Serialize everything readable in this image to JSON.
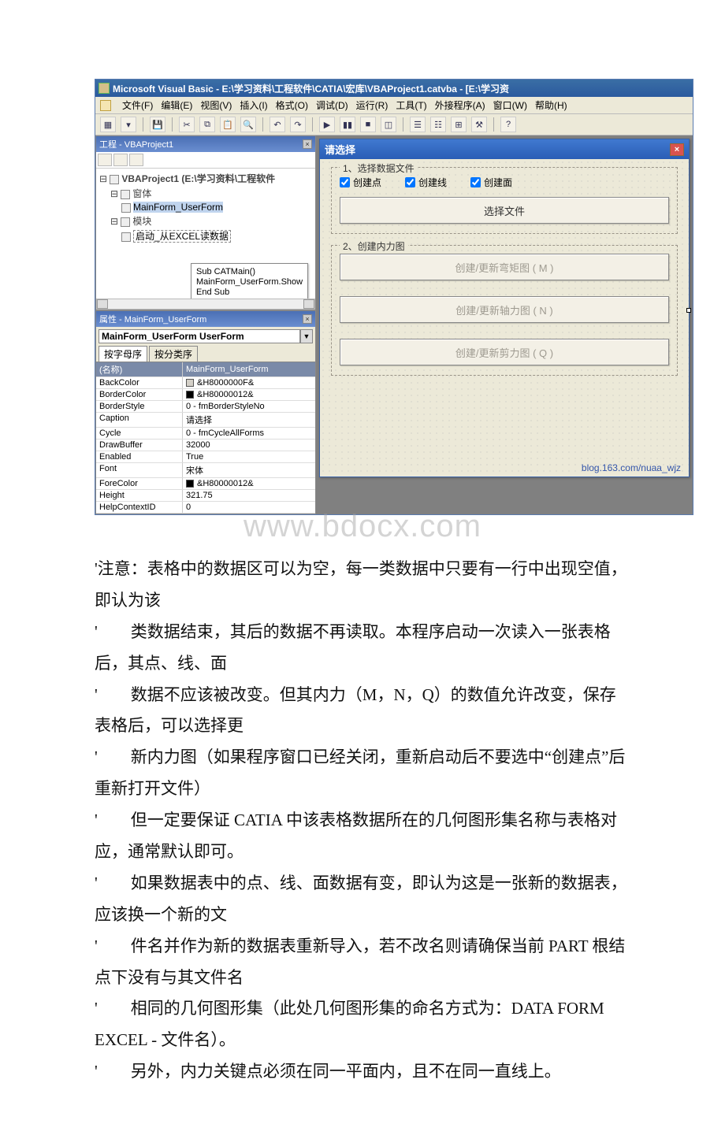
{
  "window": {
    "title": "Microsoft Visual Basic - E:\\学习资料\\工程软件\\CATIA\\宏库\\VBAProject1.catvba - [E:\\学习资"
  },
  "menu": {
    "file": "文件(F)",
    "edit": "编辑(E)",
    "view": "视图(V)",
    "insert": "插入(I)",
    "format": "格式(O)",
    "debug": "调试(D)",
    "run": "运行(R)",
    "tools": "工具(T)",
    "addins": "外接程序(A)",
    "window": "窗口(W)",
    "help": "帮助(H)"
  },
  "project_panel": {
    "title": "工程 - VBAProject1",
    "root": "VBAProject1 (E:\\学习资料\\工程软件",
    "forms_folder": "窗体",
    "form_item": "MainForm_UserForm",
    "modules_folder": "模块",
    "module_item": "启动_从EXCEL读数据"
  },
  "code_hint": {
    "line1": "Sub CATMain()",
    "line2": "MainForm_UserForm.Show",
    "line3": "End Sub"
  },
  "properties_panel": {
    "title": "属性 - MainForm_UserForm",
    "combo_value": "MainForm_UserForm UserForm",
    "tab_alpha": "按字母序",
    "tab_category": "按分类序",
    "header_name": "(名称)",
    "header_value": "MainForm_UserForm",
    "rows": [
      {
        "name": "BackColor",
        "value": "&H8000000F&",
        "swatch": "grey"
      },
      {
        "name": "BorderColor",
        "value": "&H80000012&",
        "swatch": "black"
      },
      {
        "name": "BorderStyle",
        "value": "0 - fmBorderStyleNo"
      },
      {
        "name": "Caption",
        "value": "请选择"
      },
      {
        "name": "Cycle",
        "value": "0 - fmCycleAllForms"
      },
      {
        "name": "DrawBuffer",
        "value": "32000"
      },
      {
        "name": "Enabled",
        "value": "True"
      },
      {
        "name": "Font",
        "value": "宋体"
      },
      {
        "name": "ForeColor",
        "value": "&H80000012&",
        "swatch": "black"
      },
      {
        "name": "Height",
        "value": "321.75"
      },
      {
        "name": "HelpContextID",
        "value": "0"
      }
    ]
  },
  "form": {
    "caption": "请选择",
    "group1_label": "1、选择数据文件",
    "chk_point": "创建点",
    "chk_line": "创建线",
    "chk_face": "创建面",
    "btn_select_file": "选择文件",
    "group2_label": "2、创建内力图",
    "btn_moment": "创建/更新弯矩图 ( M )",
    "btn_axial": "创建/更新轴力图 ( N )",
    "btn_shear": "创建/更新剪力图 ( Q )",
    "blog": "blog.163.com/nuaa_wjz"
  },
  "watermark": "www.bdocx.com",
  "article": {
    "p1": "'注意：表格中的数据区可以为空，每一类数据中只要有一行中出现空值，即认为该",
    "p2": "'　　类数据结束，其后的数据不再读取。本程序启动一次读入一张表格后，其点、线、面",
    "p3": "'　　数据不应该被改变。但其内力（M，N，Q）的数值允许改变，保存表格后，可以选择更",
    "p4": "'　　新内力图（如果程序窗口已经关闭，重新启动后不要选中“创建点”后重新打开文件）",
    "p5": "'　　但一定要保证 CATIA 中该表格数据所在的几何图形集名称与表格对应，通常默认即可。",
    "p6": "'　　如果数据表中的点、线、面数据有变，即认为这是一张新的数据表，应该换一个新的文",
    "p7": "'　　件名并作为新的数据表重新导入，若不改名则请确保当前 PART 根结点下没有与其文件名",
    "p8": "'　　相同的几何图形集（此处几何图形集的命名方式为：DATA FORM EXCEL - 文件名）。",
    "p9": "'　　另外，内力关键点必须在同一平面内，且不在同一直线上。"
  }
}
